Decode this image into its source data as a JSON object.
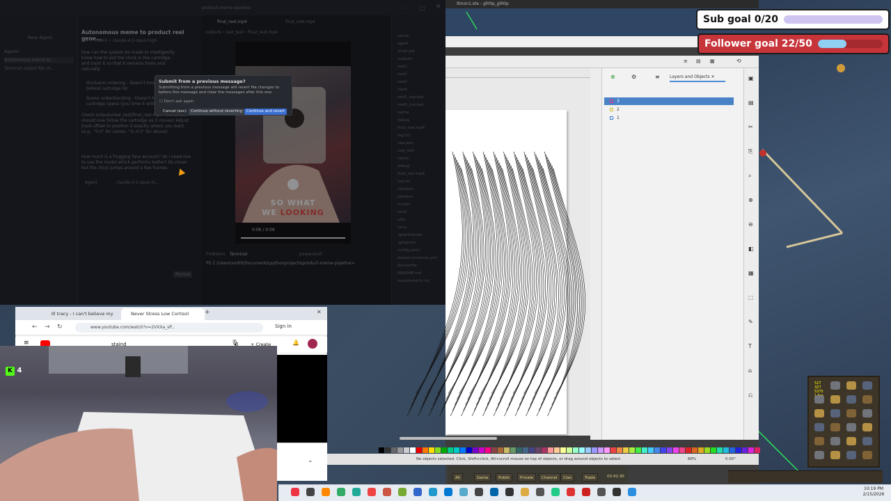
{
  "ide": {
    "window_title": "product-meme-pipeline",
    "sidebar_new_agent": "New Agent",
    "sidebar_section": "Agents",
    "sidebar_item_1": "Autonomous meme to ...",
    "sidebar_item_2": "Terminal output file ch...",
    "chat_title": "Autonomous meme to product reel gene...",
    "chat_meta": "5m • +1845 • claude-4.5-opus-high",
    "chat_p1": "how can the system be made to intelligently know how to put the chick in the cartridge, and track it so that it remains there and naturally",
    "bullet_1": "Occlusion ordering - Doesn't know the chick goes behind cartridge lid",
    "bullet_2": "Scene understanding - Doesn't know where the cartridge opens (you time it with...",
    "chat_p2": "Check outputs/reel_test/final_reel.mp4 - the chick should now follow the cartridge as it moves! Adjust track.offset to position it exactly where you want (e.g., \"0,0\" for center, \"0,-0.5\" for above).",
    "chat_p3": "how much is a frugging face account? do i need one to use the model which performs better? its closer but the chick jumps around a few frames",
    "chat_input_label": "Agent",
    "chat_input_model": "claude-4.5-opus-hi...",
    "review_label": "Review",
    "editor_tab_1": "final_reel.mp4",
    "editor_tab_2": "final_reel.mp4",
    "breadcrumb": "outputs › reel_test › final_reel.mp4",
    "video_caption_1": "SO WHAT",
    "video_caption_2a": "WE ",
    "video_caption_2b": "LOOKING",
    "video_time": "0:06 / 0:06",
    "panel_tab_problems": "Problems",
    "panel_tab_terminal": "Terminal",
    "terminal_shell": "powershell",
    "terminal_line": "PS C:\\Users\\smith\\Documents\\pythonprojects\\product-meme-pipeline>",
    "dialog": {
      "title": "Submit from a previous message?",
      "body": "Submitting from a previous message will revert file changes to before this message and clear the messages after this one.",
      "checkbox": "Don't ask again",
      "cancel": "Cancel (esc)",
      "continue_no_revert": "Continue without reverting",
      "continue_revert": "Continue and revert"
    },
    "explorer_items": [
      "cache",
      "agent",
      "chick.oof",
      "outputs",
      "reel1",
      "reel2",
      "reel3",
      "reel4",
      "reel5_tracked",
      "reel6_tracked",
      "cache",
      "debug",
      "final_reel.mp4",
      "log.txt",
      "raw.json",
      "reel_test",
      "cache",
      "debug",
      "final_reel.mp4",
      "log.txt",
      "raw.json",
      "pipeline",
      "scripts",
      "tests",
      "utils",
      "venv",
      ".gitattributes",
      ".gitignore",
      "config.yaml",
      "docker-compose.yml",
      "Dockerfile",
      "README.md",
      "requirements.txt"
    ]
  },
  "inkscape": {
    "title": "Itinon1.ste - gl00p_gl00p",
    "panel_title": "Layers and Objects",
    "layers": [
      "3",
      "2",
      "1"
    ],
    "status": "No objects selected. Click, Shift+click, Alt+scroll mouse on top of objects, or drag around objects to select.",
    "zoom": "88%",
    "rotation": "0.00°",
    "layer_colors": [
      "#e0338a",
      "#c9c233",
      "#3a7fd6"
    ]
  },
  "overlays": {
    "sub_goal": "Sub goal 0/20",
    "sub_goal_value": 0,
    "sub_goal_target": 20,
    "follower_goal": "Follower goal 22/50",
    "follower_goal_value": 22,
    "follower_goal_target": 50,
    "kick_count": "4"
  },
  "browser": {
    "tab_1": "Ill tracy - I can't believe my eyes",
    "tab_2": "Never Stress Low Cortisol",
    "url": "www.youtube.com/watch?v=2VXXa_sP...",
    "sign_in": "Sign in",
    "search_text": "staind",
    "create": "Create",
    "notifications": "0"
  },
  "game": {
    "chat_tabs": [
      "All",
      "Game",
      "Public",
      "Private",
      "Channel",
      "Clan",
      "Trade"
    ],
    "timer": "03:41:30",
    "stats": [
      "527",
      "327",
      "5375",
      "1.5m"
    ]
  },
  "taskbar": {
    "time": "10:19 PM",
    "date": "2/15/2026"
  },
  "colors": {
    "accent_blue": "#4a82c8",
    "goal_red": "#c7343a",
    "goal_bar": "#8fd0f3",
    "continue_button": "#3a6fd1"
  }
}
